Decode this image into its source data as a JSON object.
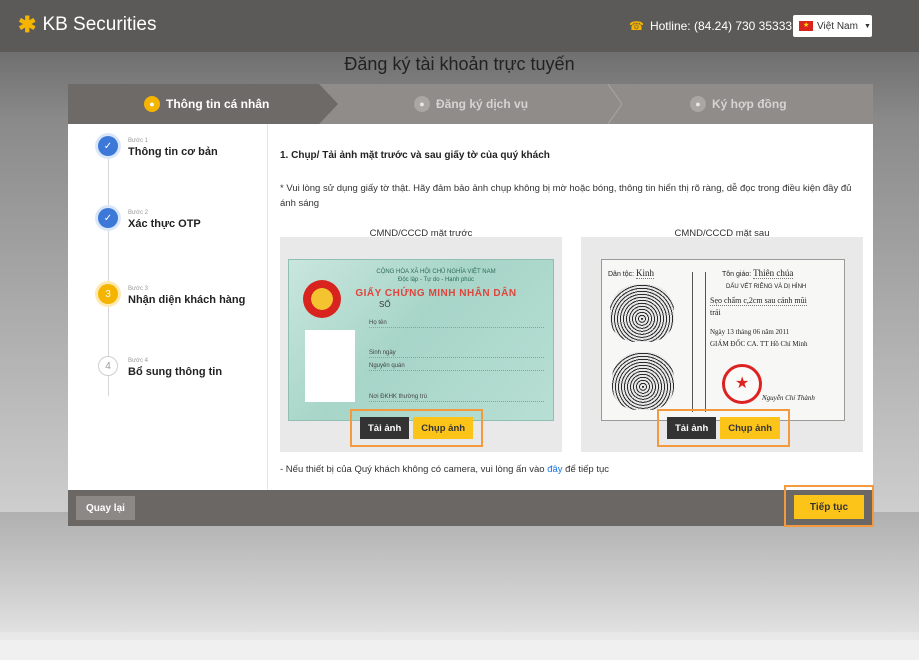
{
  "app": {
    "brand": "KB Securities",
    "hotline": "Hotline: (84.24) 730 35333",
    "language": "Việt Nam"
  },
  "page_title": "Đăng ký tài khoản trực tuyến",
  "top_steps": [
    {
      "label": "Thông tin cá nhân"
    },
    {
      "label": "Đăng ký dịch vụ"
    },
    {
      "label": "Ký hợp đồng"
    }
  ],
  "sidebar_steps": [
    {
      "small": "Bước 1",
      "title": "Thông tin cơ bản",
      "mark": "✓"
    },
    {
      "small": "Bước 2",
      "title": "Xác thực OTP",
      "mark": "✓"
    },
    {
      "small": "Bước 3",
      "title": "Nhận diện khách hàng",
      "mark": "3"
    },
    {
      "small": "Bước 4",
      "title": "Bổ sung thông tin",
      "mark": "4"
    }
  ],
  "content": {
    "section_title": "1. Chụp/ Tải ảnh mặt trước và sau giấy tờ của quý khách",
    "note": "* Vui lòng sử dụng giấy tờ thật. Hãy đảm bảo ảnh chụp không bị mờ hoặc bóng, thông tin hiển thị rõ ràng, dễ đọc trong điều kiện đầy đủ ánh sáng",
    "front_label": "CMND/CCCD mặt trước",
    "back_label": "CMND/CCCD mặt sau",
    "upload_label": "Tải ảnh",
    "capture_label": "Chụp ảnh",
    "footnote_pre": "- Nếu thiết bị của Quý khách không có camera, vui lòng ấn vào ",
    "footnote_link": "đây",
    "footnote_post": " để tiếp tục"
  },
  "front_card": {
    "header1": "CỘNG HÒA XÃ HỘI CHỦ NGHĨA VIỆT NAM",
    "header2": "Độc lập - Tự do - Hạnh phúc",
    "title": "GIẤY CHỨNG MINH NHÂN DÂN",
    "so": "SỐ",
    "field_name": "Họ tên",
    "field_dob": "Sinh ngày",
    "field_origin": "Nguyên quán",
    "field_residence": "Nơi ĐKHK thường trú"
  },
  "back_card": {
    "ethnic_label": "Dân tộc:",
    "ethnic_value": "Kinh",
    "religion_label": "Tôn giáo:",
    "religion_value": "Thiên chúa",
    "marks_title": "DẤU VẾT RIÊNG VÀ DỊ HÌNH",
    "marks_value": "Sẹo chấm c,2cm sau cánh mũi",
    "marks_value2": "trái",
    "date_line": "Ngày 13 tháng 06 năm 2011",
    "issuer": "GIÁM ĐỐC CA. TT Hồ Chí Minh",
    "signer": "Nguyễn Chí Thành"
  },
  "footer": {
    "back_label": "Quay lại",
    "next_label": "Tiếp tục"
  },
  "colors": {
    "accent": "#fcc419",
    "highlight_border": "#f29a3d",
    "step_done": "#3b78d8",
    "header_bg": "#5c5a58"
  }
}
